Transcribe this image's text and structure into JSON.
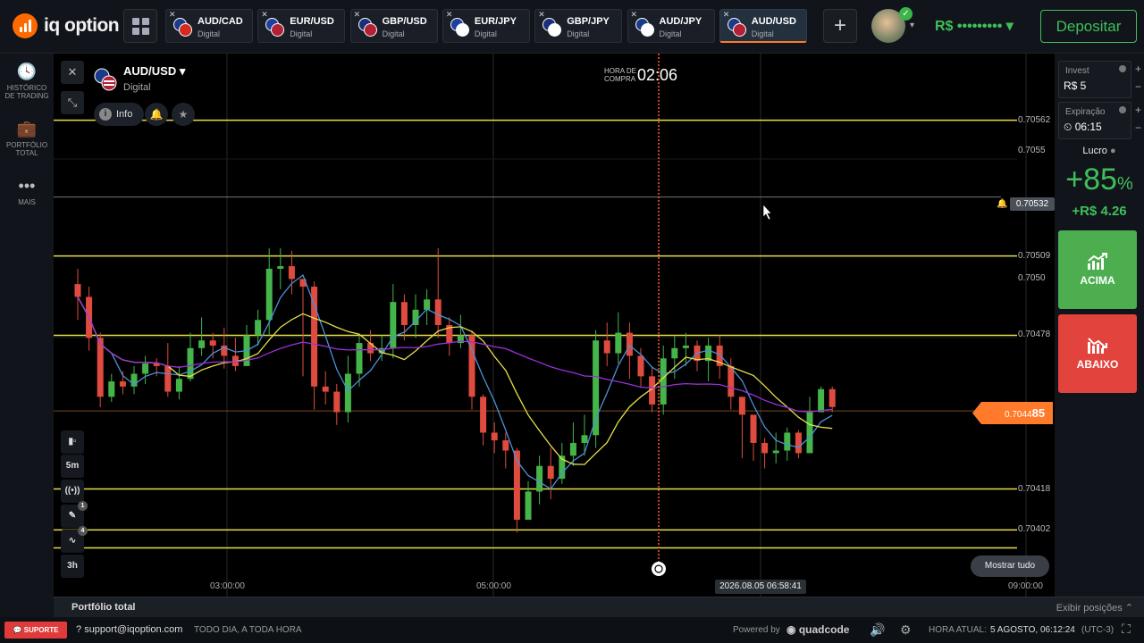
{
  "header": {
    "logo_text": "iq option",
    "tabs": [
      {
        "name": "AUD/CAD",
        "sub": "Digital",
        "c1": "#1a3a8a",
        "c2": "#d52b1e"
      },
      {
        "name": "EUR/USD",
        "sub": "Digital",
        "c1": "#1e3fa0",
        "c2": "#b22234"
      },
      {
        "name": "GBP/USD",
        "sub": "Digital",
        "c1": "#1a2f7a",
        "c2": "#b22234"
      },
      {
        "name": "EUR/JPY",
        "sub": "Digital",
        "c1": "#1e3fa0",
        "c2": "#ffffff"
      },
      {
        "name": "GBP/JPY",
        "sub": "Digital",
        "c1": "#1a2f7a",
        "c2": "#ffffff"
      },
      {
        "name": "AUD/JPY",
        "sub": "Digital",
        "c1": "#1a3a8a",
        "c2": "#ffffff"
      },
      {
        "name": "AUD/USD",
        "sub": "Digital",
        "c1": "#1a3a8a",
        "c2": "#b22234"
      }
    ],
    "plus_label": "+",
    "balance": "R$ ••••••••• ▾",
    "deposit_label": "Depositar"
  },
  "left_sidebar": {
    "history_label_1": "HISTÓRICO",
    "history_label_2": "DE TRADING",
    "portfolio_label_1": "PORTFÓLIO",
    "portfolio_label_2": "TOTAL",
    "more_label": "MAIS"
  },
  "chart_panel": {
    "asset_name": "AUD/USD",
    "asset_type": "Digital",
    "info_label": "Info",
    "purchase_label_1": "HORA DE",
    "purchase_label_2": "COMPRA",
    "purchase_time": "02:06",
    "timeframe_label": "5m",
    "period_label": "3h",
    "drawing_badge": "1",
    "indicator_badge": "4",
    "show_all_label": "Mostrar tudo",
    "cursor_timestamp": "2026.08.05 06:58:41",
    "alert_price": "0.70532",
    "current_price_main": "0.7044",
    "current_price_tail": "85",
    "price_labels": [
      {
        "value": "0.70562"
      },
      {
        "value": "0.7055"
      },
      {
        "value": "0.70509"
      },
      {
        "value": "0.7050"
      },
      {
        "value": "0.70478"
      },
      {
        "value": "0.70418"
      },
      {
        "value": "0.70402"
      }
    ],
    "x_labels": [
      "03:00:00",
      "05:00:00",
      "09:00:00"
    ]
  },
  "chart_data": {
    "type": "candlestick",
    "y_levels_horizontal": [
      0.70562,
      0.70509,
      0.70478,
      0.70418,
      0.70402
    ],
    "current_price": 0.704485,
    "alert_price": 0.70532,
    "x_ticks": [
      "03:00:00",
      "05:00:00",
      "09:00:00"
    ],
    "candles": [
      [
        0.70498,
        0.70493,
        0.70504,
        0.70484
      ],
      [
        0.70493,
        0.70477,
        0.70497,
        0.70472
      ],
      [
        0.70477,
        0.70454,
        0.70479,
        0.7045
      ],
      [
        0.70454,
        0.7046,
        0.70463,
        0.70452
      ],
      [
        0.7046,
        0.70458,
        0.70464,
        0.70455
      ],
      [
        0.70458,
        0.70463,
        0.70466,
        0.70455
      ],
      [
        0.70463,
        0.70467,
        0.7047,
        0.70459
      ],
      [
        0.70467,
        0.70466,
        0.70469,
        0.70462
      ],
      [
        0.70466,
        0.70456,
        0.70475,
        0.70454
      ],
      [
        0.70456,
        0.70461,
        0.70466,
        0.70453
      ],
      [
        0.70461,
        0.70473,
        0.70479,
        0.7046
      ],
      [
        0.70473,
        0.70476,
        0.70485,
        0.7047
      ],
      [
        0.70476,
        0.70474,
        0.70479,
        0.70469
      ],
      [
        0.70474,
        0.7047,
        0.70481,
        0.70465
      ],
      [
        0.7047,
        0.70466,
        0.70477,
        0.70464
      ],
      [
        0.70466,
        0.70478,
        0.70482,
        0.70466
      ],
      [
        0.70478,
        0.70484,
        0.70488,
        0.70474
      ],
      [
        0.70484,
        0.70504,
        0.70512,
        0.70478
      ],
      [
        0.70504,
        0.70505,
        0.70512,
        0.70496
      ],
      [
        0.70505,
        0.705,
        0.70511,
        0.70494
      ],
      [
        0.705,
        0.70497,
        0.70499,
        0.70462
      ],
      [
        0.70497,
        0.70458,
        0.70499,
        0.70449
      ],
      [
        0.70458,
        0.70456,
        0.70464,
        0.70451
      ],
      [
        0.70456,
        0.70448,
        0.70459,
        0.70443
      ],
      [
        0.70448,
        0.70463,
        0.7047,
        0.70444
      ],
      [
        0.70463,
        0.70475,
        0.70478,
        0.70458
      ],
      [
        0.70475,
        0.70471,
        0.7048,
        0.70468
      ],
      [
        0.70471,
        0.70473,
        0.70478,
        0.70468
      ],
      [
        0.70473,
        0.70491,
        0.70498,
        0.70469
      ],
      [
        0.70491,
        0.70482,
        0.70494,
        0.70476
      ],
      [
        0.70482,
        0.70488,
        0.70494,
        0.70477
      ],
      [
        0.70488,
        0.70492,
        0.70496,
        0.70482
      ],
      [
        0.70492,
        0.70482,
        0.70512,
        0.70477
      ],
      [
        0.70482,
        0.70475,
        0.70485,
        0.7047
      ],
      [
        0.70475,
        0.70478,
        0.70486,
        0.70473
      ],
      [
        0.70478,
        0.70454,
        0.7048,
        0.70449
      ],
      [
        0.70454,
        0.7044,
        0.70455,
        0.70435
      ],
      [
        0.7044,
        0.70437,
        0.70444,
        0.70432
      ],
      [
        0.70437,
        0.70433,
        0.7044,
        0.70426
      ],
      [
        0.70433,
        0.70406,
        0.70434,
        0.70401
      ],
      [
        0.70406,
        0.70417,
        0.70421,
        0.70409
      ],
      [
        0.70417,
        0.70427,
        0.70431,
        0.70412
      ],
      [
        0.70427,
        0.70422,
        0.70434,
        0.70414
      ],
      [
        0.70422,
        0.70431,
        0.70436,
        0.7042
      ],
      [
        0.70431,
        0.70436,
        0.70444,
        0.70427
      ],
      [
        0.70436,
        0.70439,
        0.70447,
        0.70431
      ],
      [
        0.70439,
        0.70476,
        0.7048,
        0.70434
      ],
      [
        0.70476,
        0.70471,
        0.70483,
        0.70466
      ],
      [
        0.70471,
        0.70479,
        0.70487,
        0.70467
      ],
      [
        0.70479,
        0.7047,
        0.70483,
        0.70461
      ],
      [
        0.7047,
        0.70462,
        0.70473,
        0.70458
      ],
      [
        0.70462,
        0.70451,
        0.70466,
        0.70448
      ],
      [
        0.70451,
        0.70469,
        0.70474,
        0.70447
      ],
      [
        0.70469,
        0.70473,
        0.70478,
        0.70461
      ],
      [
        0.70473,
        0.70474,
        0.70479,
        0.70466
      ],
      [
        0.70474,
        0.70468,
        0.70476,
        0.70464
      ],
      [
        0.70468,
        0.70474,
        0.70477,
        0.7046
      ],
      [
        0.70474,
        0.70466,
        0.70478,
        0.70461
      ],
      [
        0.70466,
        0.70454,
        0.70469,
        0.70449
      ],
      [
        0.70454,
        0.70447,
        0.70451,
        0.7043
      ],
      [
        0.70447,
        0.70436,
        0.70444,
        0.70429
      ],
      [
        0.70436,
        0.70432,
        0.70438,
        0.70426
      ],
      [
        0.70432,
        0.70433,
        0.7044,
        0.70428
      ],
      [
        0.70433,
        0.7044,
        0.70442,
        0.70429
      ],
      [
        0.7044,
        0.70432,
        0.70441,
        0.7043
      ],
      [
        0.70432,
        0.70448,
        0.70454,
        0.70432
      ],
      [
        0.70448,
        0.70457,
        0.70458,
        0.70448
      ],
      [
        0.70457,
        0.7045,
        0.70458,
        0.70448
      ]
    ],
    "series": [
      {
        "name": "",
        "color": "#4a90d9"
      },
      {
        "name": "",
        "color": "#e6e047"
      },
      {
        "name": "",
        "color": "#9b30d9"
      }
    ],
    "ylim": [
      0.70376,
      0.70588
    ]
  },
  "right_panel": {
    "invest_title": "Invest",
    "invest_value": "R$ 5",
    "expiry_title": "Expiração",
    "expiry_value": "⏲ 06:15",
    "profit_title": "Lucro",
    "profit_pct": "+85",
    "profit_pct_sym": "%",
    "profit_value": "+R$ 4.26",
    "up_label": "ACIMA",
    "down_label": "ABAIXO",
    "up_color": "#4cae4f",
    "down_color": "#e2433c"
  },
  "portfolio_bar": {
    "left": "Portfólio total",
    "right": "Exibir posições ⌃"
  },
  "footer": {
    "support": "SUPORTE",
    "email": "support@iqoption.com",
    "hours": "TODO DIA, A TODA HORA",
    "powered": "Powered by",
    "brand": "quadcode",
    "time_label": "HORA ATUAL:",
    "time_value": "5 AGOSTO, 06:12:24",
    "tz": "(UTC-3)"
  }
}
